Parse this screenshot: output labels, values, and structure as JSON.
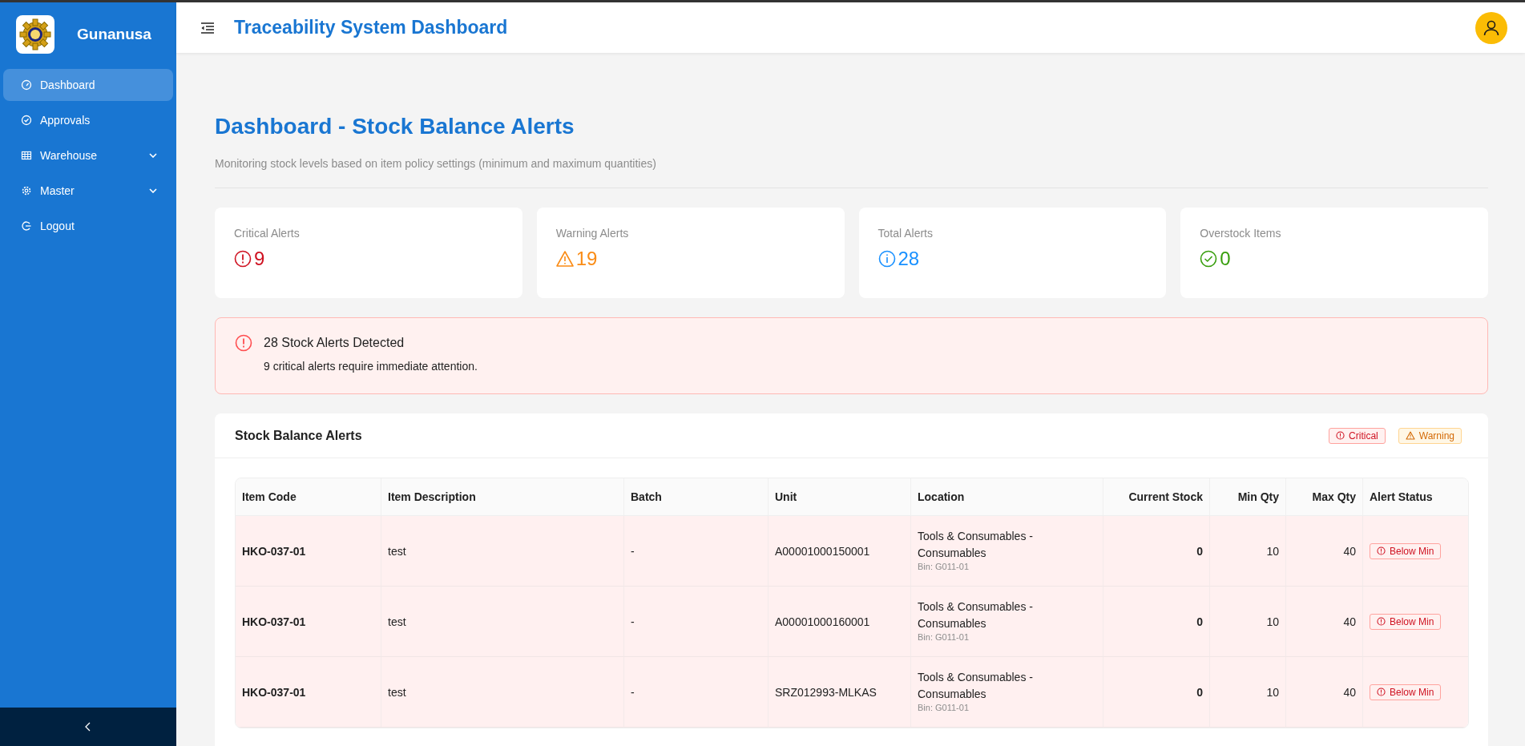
{
  "sidebar": {
    "brand": "Gunanusa",
    "items": [
      {
        "label": "Dashboard",
        "selected": true,
        "expandable": false
      },
      {
        "label": "Approvals",
        "selected": false,
        "expandable": false
      },
      {
        "label": "Warehouse",
        "selected": false,
        "expandable": true
      },
      {
        "label": "Master",
        "selected": false,
        "expandable": true
      },
      {
        "label": "Logout",
        "selected": false,
        "expandable": false
      }
    ]
  },
  "header": {
    "title": "Traceability System Dashboard"
  },
  "page": {
    "title": "Dashboard - Stock Balance Alerts",
    "subtitle": "Monitoring stock levels based on item policy settings (minimum and maximum quantities)"
  },
  "stats": [
    {
      "label": "Critical Alerts",
      "value": "9",
      "kind": "critical"
    },
    {
      "label": "Warning Alerts",
      "value": "19",
      "kind": "warning"
    },
    {
      "label": "Total Alerts",
      "value": "28",
      "kind": "info"
    },
    {
      "label": "Overstock Items",
      "value": "0",
      "kind": "success"
    }
  ],
  "alert": {
    "title": "28 Stock Alerts Detected",
    "message": "9 critical alerts require immediate attention."
  },
  "table": {
    "title": "Stock Balance Alerts",
    "legend": [
      {
        "label": "Critical",
        "kind": "critical"
      },
      {
        "label": "Warning",
        "kind": "warning"
      }
    ],
    "columns": [
      "Item Code",
      "Item Description",
      "Batch",
      "Unit",
      "Location",
      "Current Stock",
      "Min Qty",
      "Max Qty",
      "Alert Status"
    ],
    "rows": [
      {
        "item_code": "HKO-037-01",
        "description": "test",
        "batch": "-",
        "unit": "A00001000150001",
        "location": "Tools & Consumables - Consumables",
        "bin": "Bin: G011-01",
        "current_stock": "0",
        "min_qty": "10",
        "max_qty": "40",
        "status": "Below Min",
        "kind": "critical"
      },
      {
        "item_code": "HKO-037-01",
        "description": "test",
        "batch": "-",
        "unit": "A00001000160001",
        "location": "Tools & Consumables - Consumables",
        "bin": "Bin: G011-01",
        "current_stock": "0",
        "min_qty": "10",
        "max_qty": "40",
        "status": "Below Min",
        "kind": "critical"
      },
      {
        "item_code": "HKO-037-01",
        "description": "test",
        "batch": "-",
        "unit": "SRZ012993-MLKAS",
        "location": "Tools & Consumables - Consumables",
        "bin": "Bin: G011-01",
        "current_stock": "0",
        "min_qty": "10",
        "max_qty": "40",
        "status": "Below Min",
        "kind": "critical"
      }
    ]
  }
}
